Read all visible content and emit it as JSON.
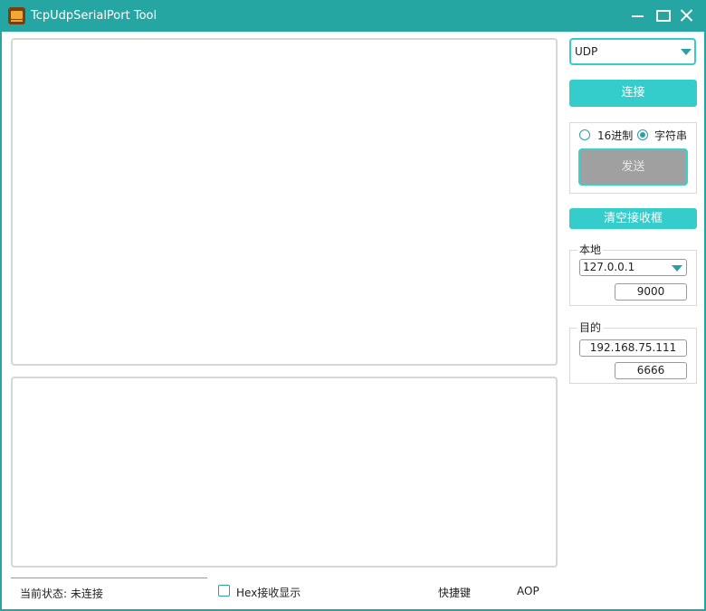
{
  "window": {
    "title": "TcpUdpSerialPort Tool"
  },
  "protocol": {
    "selected": "UDP"
  },
  "buttons": {
    "connect": "连接",
    "send": "发送",
    "clear_recv": "清空接收框"
  },
  "send_mode": {
    "hex_label": "16进制",
    "string_label": "字符串",
    "selected": "string"
  },
  "local": {
    "legend": "本地",
    "ip": "127.0.0.1",
    "port": "9000"
  },
  "destination": {
    "legend": "目的",
    "ip": "192.168.75.111",
    "port": "6666"
  },
  "status": {
    "text": "当前状态: 未连接",
    "hex_display_label": "Hex接收显示",
    "hex_display_checked": false,
    "shortcut_label": "快捷键",
    "aop_label": "AOP"
  },
  "colors": {
    "accent": "#34cdcc",
    "titlebar": "#26a6a2",
    "send_disabled": "#a0a0a0"
  }
}
